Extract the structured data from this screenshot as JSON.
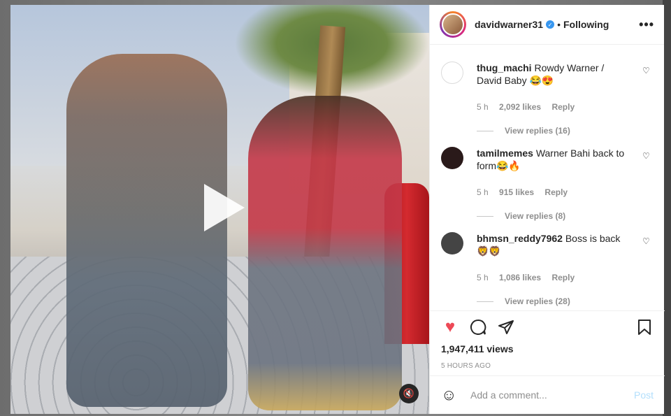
{
  "post": {
    "username": "davidwarner31",
    "follow_separator": "•",
    "follow_status": "Following",
    "more_icon": "more-horizontal-icon"
  },
  "comments": [
    {
      "user": "thug_machi",
      "text": "Rowdy Warner / David Baby 😂😍",
      "time": "5 h",
      "likes": "2,092 likes",
      "reply": "Reply",
      "view_replies": "View replies (16)",
      "avatar_color": "#ffffff"
    },
    {
      "user": "tamilmemes",
      "text": "Warner Bahi back to form😂🔥",
      "time": "5 h",
      "likes": "915 likes",
      "reply": "Reply",
      "view_replies": "View replies (8)",
      "avatar_color": "#2a1a1a"
    },
    {
      "user": "bhmsn_reddy7962",
      "text": "Boss is back 🦁🦁",
      "time": "5 h",
      "likes": "1,086 likes",
      "reply": "Reply",
      "view_replies": "View replies (28)",
      "avatar_color": "#444444"
    }
  ],
  "actions": {
    "views": "1,947,411 views",
    "posted": "5 HOURS AGO",
    "like_color": "#ed4956"
  },
  "add_comment": {
    "placeholder": "Add a comment...",
    "post_label": "Post"
  }
}
